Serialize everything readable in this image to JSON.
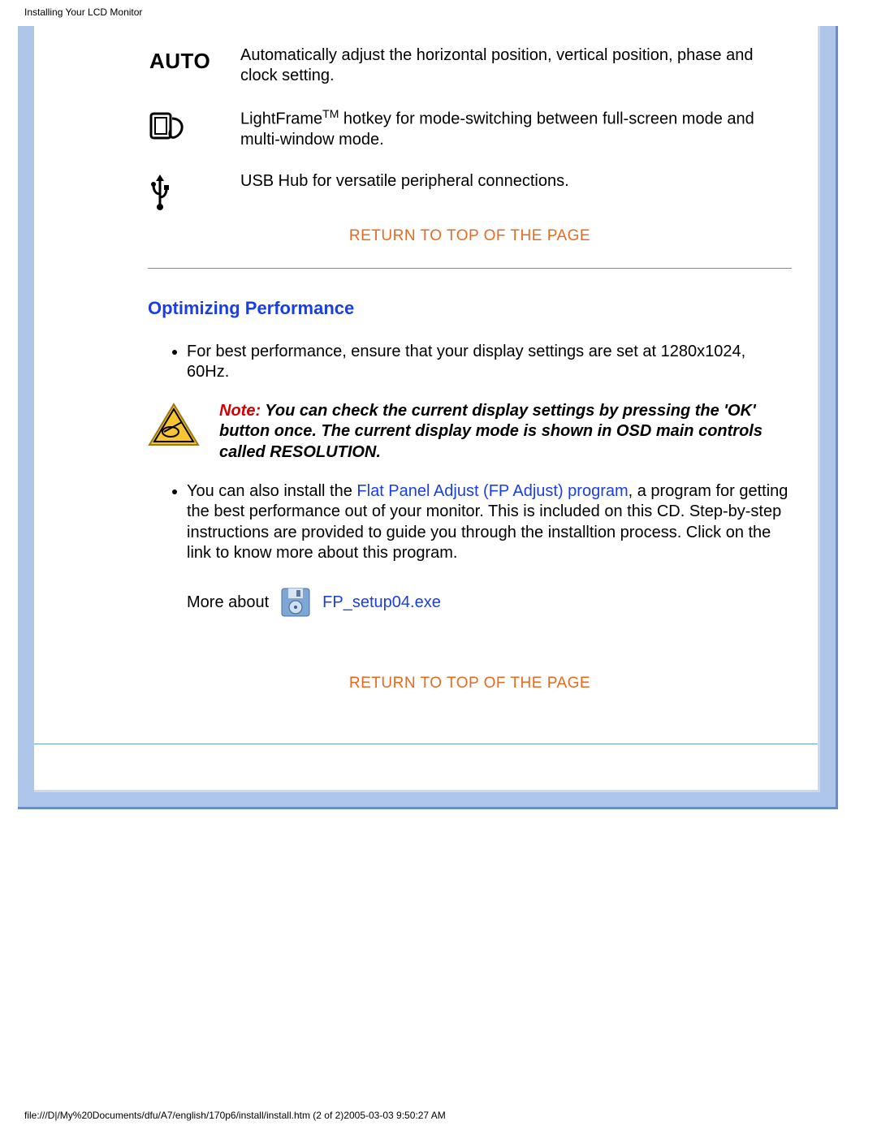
{
  "header": {
    "title": "Installing Your LCD Monitor"
  },
  "icons": {
    "auto": {
      "label": "AUTO",
      "description": "Automatically adjust the horizontal position, vertical position, phase and clock setting."
    },
    "lightframe": {
      "description_prefix": "LightFrame",
      "tm": "TM",
      "description_suffix": " hotkey for mode-switching between full-screen mode and multi-window mode."
    },
    "usb": {
      "description": "USB Hub for versatile peripheral connections."
    }
  },
  "return_link": "RETURN TO TOP OF THE PAGE",
  "section": {
    "heading": "Optimizing Performance",
    "bullet1": "For best performance, ensure that your display settings are set at 1280x1024, 60Hz.",
    "note_label": "Note:",
    "note_body": " You can check the current display settings by pressing the 'OK' button once. The current display mode is shown in OSD main controls called RESOLUTION.",
    "bullet2_pre": "You can also install the ",
    "bullet2_link": "Flat Panel Adjust (FP Adjust) program",
    "bullet2_post": ", a program for getting the best performance out of your monitor. This is included on this CD. Step-by-step instructions are provided to guide you through the installtion process. Click on the link to know more about this program.",
    "more_about": "More about",
    "fp_file": "FP_setup04.exe"
  },
  "footer": {
    "path": "file:///D|/My%20Documents/dfu/A7/english/170p6/install/install.htm (2 of 2)2005-03-03 9:50:27 AM"
  }
}
